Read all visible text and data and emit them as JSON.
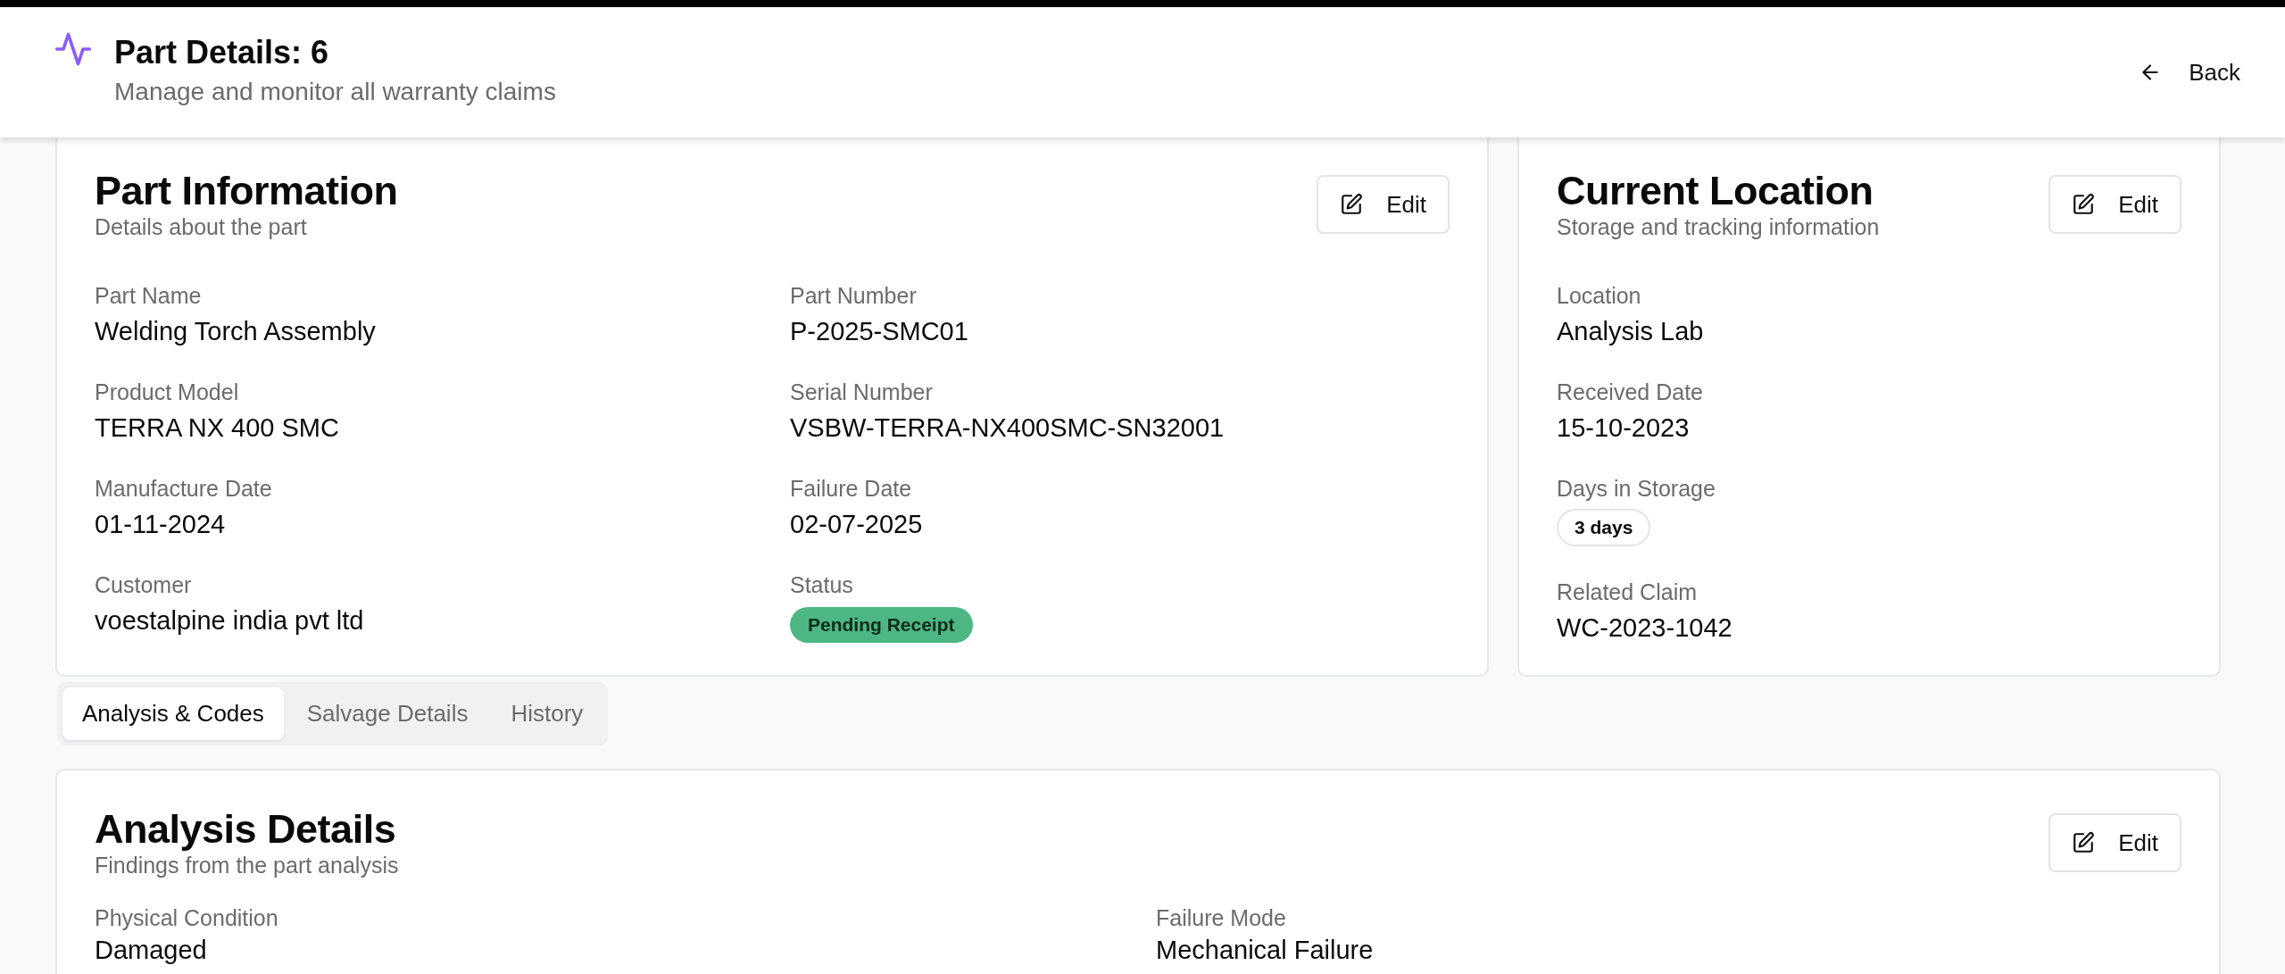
{
  "header": {
    "title": "Part Details: 6",
    "subtitle": "Manage and monitor all warranty claims",
    "back_label": "Back"
  },
  "part_information": {
    "title": "Part Information",
    "subtitle": "Details about the part",
    "edit_label": "Edit",
    "fields": [
      {
        "label": "Part Name",
        "value": "Welding Torch Assembly",
        "kind": "text"
      },
      {
        "label": "Part Number",
        "value": "P-2025-SMC01",
        "kind": "text"
      },
      {
        "label": "Product Model",
        "value": "TERRA NX 400 SMC",
        "kind": "text"
      },
      {
        "label": "Serial Number",
        "value": "VSBW-TERRA-NX400SMC-SN32001",
        "kind": "text"
      },
      {
        "label": "Manufacture Date",
        "value": "01-11-2024",
        "kind": "text"
      },
      {
        "label": "Failure Date",
        "value": "02-07-2025",
        "kind": "text"
      },
      {
        "label": "Customer",
        "value": "voestalpine india pvt ltd",
        "kind": "text"
      },
      {
        "label": "Status",
        "value": "Pending Receipt",
        "kind": "status",
        "color": "#4cb782"
      }
    ]
  },
  "current_location": {
    "title": "Current Location",
    "subtitle": "Storage and tracking information",
    "edit_label": "Edit",
    "fields": [
      {
        "label": "Location",
        "value": "Analysis Lab",
        "kind": "text"
      },
      {
        "label": "Received Date",
        "value": "15-10-2023",
        "kind": "text"
      },
      {
        "label": "Days in Storage",
        "value": "3 days",
        "kind": "badge"
      },
      {
        "label": "Related Claim",
        "value": "WC-2023-1042",
        "kind": "text"
      }
    ]
  },
  "tabs": [
    {
      "label": "Analysis & Codes",
      "selected": true
    },
    {
      "label": "Salvage Details",
      "selected": false
    },
    {
      "label": "History",
      "selected": false
    }
  ],
  "analysis_details": {
    "title": "Analysis Details",
    "subtitle": "Findings from the part analysis",
    "edit_label": "Edit",
    "fields": [
      {
        "label": "Physical Condition",
        "value": "Damaged"
      },
      {
        "label": "Failure Mode",
        "value": "Mechanical Failure"
      }
    ]
  }
}
